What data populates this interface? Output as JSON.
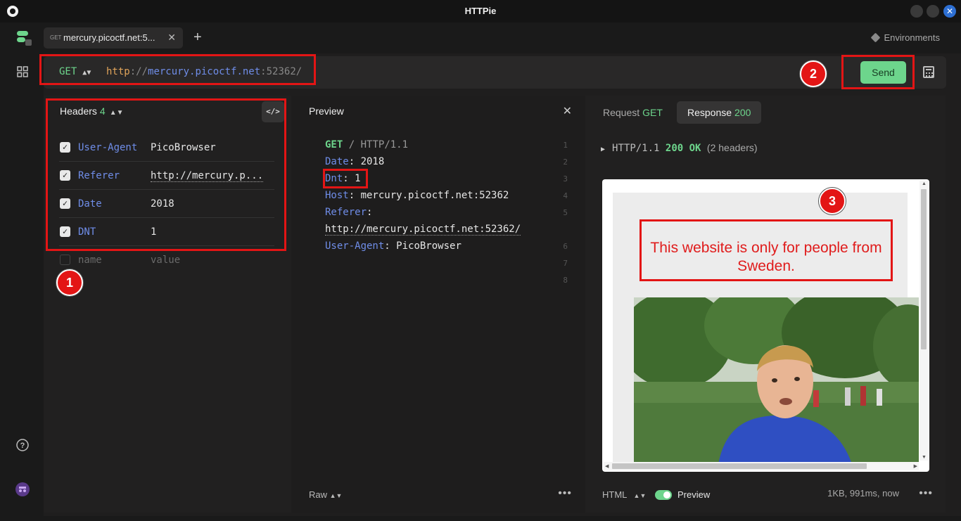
{
  "window": {
    "title": "HTTPie"
  },
  "tabs": [
    {
      "method": "GET",
      "label": "mercury.picoctf.net:5..."
    }
  ],
  "environments_label": "Environments",
  "request": {
    "method": "GET",
    "url_scheme": "http",
    "url_sep": "://",
    "url_host": "mercury.picoctf.net",
    "url_port_path": ":52362/",
    "send_label": "Send"
  },
  "headers_panel": {
    "title": "Headers",
    "count": "4",
    "rows": [
      {
        "name": "User-Agent",
        "value": "PicoBrowser",
        "checked": true
      },
      {
        "name": "Referer",
        "value": "http://mercury.p...",
        "checked": true
      },
      {
        "name": "Date",
        "value": "2018",
        "checked": true
      },
      {
        "name": "DNT",
        "value": "1",
        "checked": true
      }
    ],
    "name_placeholder": "name",
    "value_placeholder": "value"
  },
  "preview_panel": {
    "title": "Preview",
    "line1_method": "GET",
    "line1_path": "/",
    "line1_proto": "HTTP/1.1",
    "date_key": "Date",
    "date_val": "2018",
    "dnt_key": "Dnt",
    "dnt_val": "1",
    "host_key": "Host",
    "host_val": "mercury.picoctf.net:52362",
    "referer_key": "Referer",
    "referer_val": "http://mercury.picoctf.net:52362/",
    "ua_key": "User-Agent",
    "ua_val": "PicoBrowser",
    "line_numbers": [
      "1",
      "2",
      "3",
      "4",
      "5",
      "6",
      "7",
      "8"
    ],
    "raw_label": "Raw"
  },
  "response_panel": {
    "tab_request_label": "Request",
    "tab_request_method": "GET",
    "tab_response_label": "Response",
    "tab_response_status": "200",
    "status_proto": "HTTP/1.1",
    "status_code": "200 OK",
    "status_meta": "(2 headers)",
    "page_message": "This website is only for people from Sweden.",
    "format_label": "HTML",
    "preview_label": "Preview",
    "meta": "1KB, 991ms, now"
  },
  "annotations": [
    "1",
    "2",
    "3"
  ],
  "colors": {
    "accent_green": "#6dd58c",
    "key_blue": "#6f8de8",
    "annotation_red": "#e31515"
  }
}
